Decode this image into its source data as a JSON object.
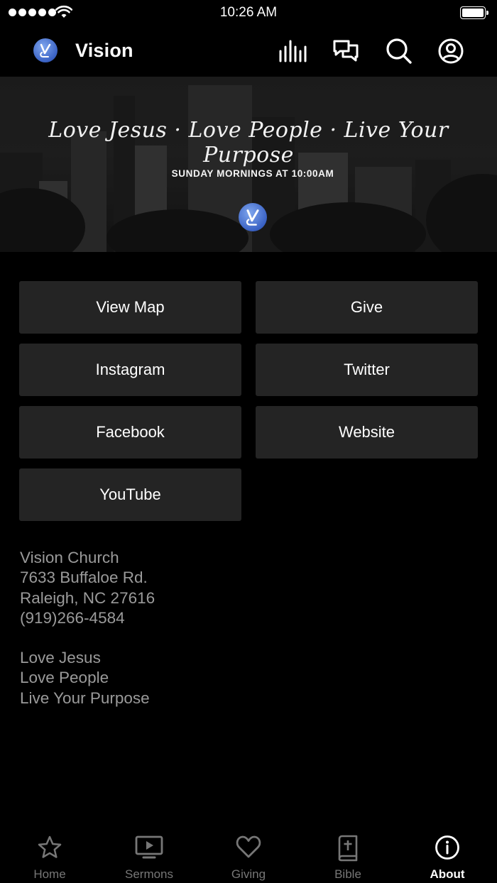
{
  "status_bar": {
    "time": "10:26 AM"
  },
  "header": {
    "title": "Vision",
    "icons": [
      "live-icon",
      "chat-icon",
      "search-icon",
      "profile-icon"
    ]
  },
  "banner": {
    "tagline": "Love Jesus · Love People · Live Your Purpose",
    "service_time": "SUNDAY MORNINGS AT 10:00AM"
  },
  "links": [
    {
      "label": "View Map"
    },
    {
      "label": "Give"
    },
    {
      "label": "Instagram"
    },
    {
      "label": "Twitter"
    },
    {
      "label": "Facebook"
    },
    {
      "label": "Website"
    },
    {
      "label": "YouTube"
    }
  ],
  "info": {
    "name": "Vision Church",
    "street": "7633 Buffaloe Rd.",
    "city": "Raleigh, NC 27616",
    "phone": "(919)266-4584",
    "motto": [
      "Love Jesus",
      "Love People",
      "Live Your Purpose"
    ]
  },
  "tabs": [
    {
      "label": "Home",
      "icon": "star-icon"
    },
    {
      "label": "Sermons",
      "icon": "tv-play-icon"
    },
    {
      "label": "Giving",
      "icon": "heart-icon"
    },
    {
      "label": "Bible",
      "icon": "bible-icon"
    },
    {
      "label": "About",
      "icon": "info-icon",
      "active": true
    }
  ],
  "colors": {
    "background": "#000000",
    "button": "#242424",
    "muted_text": "#9a9a9a",
    "brand_blue": "#3a62c4"
  }
}
